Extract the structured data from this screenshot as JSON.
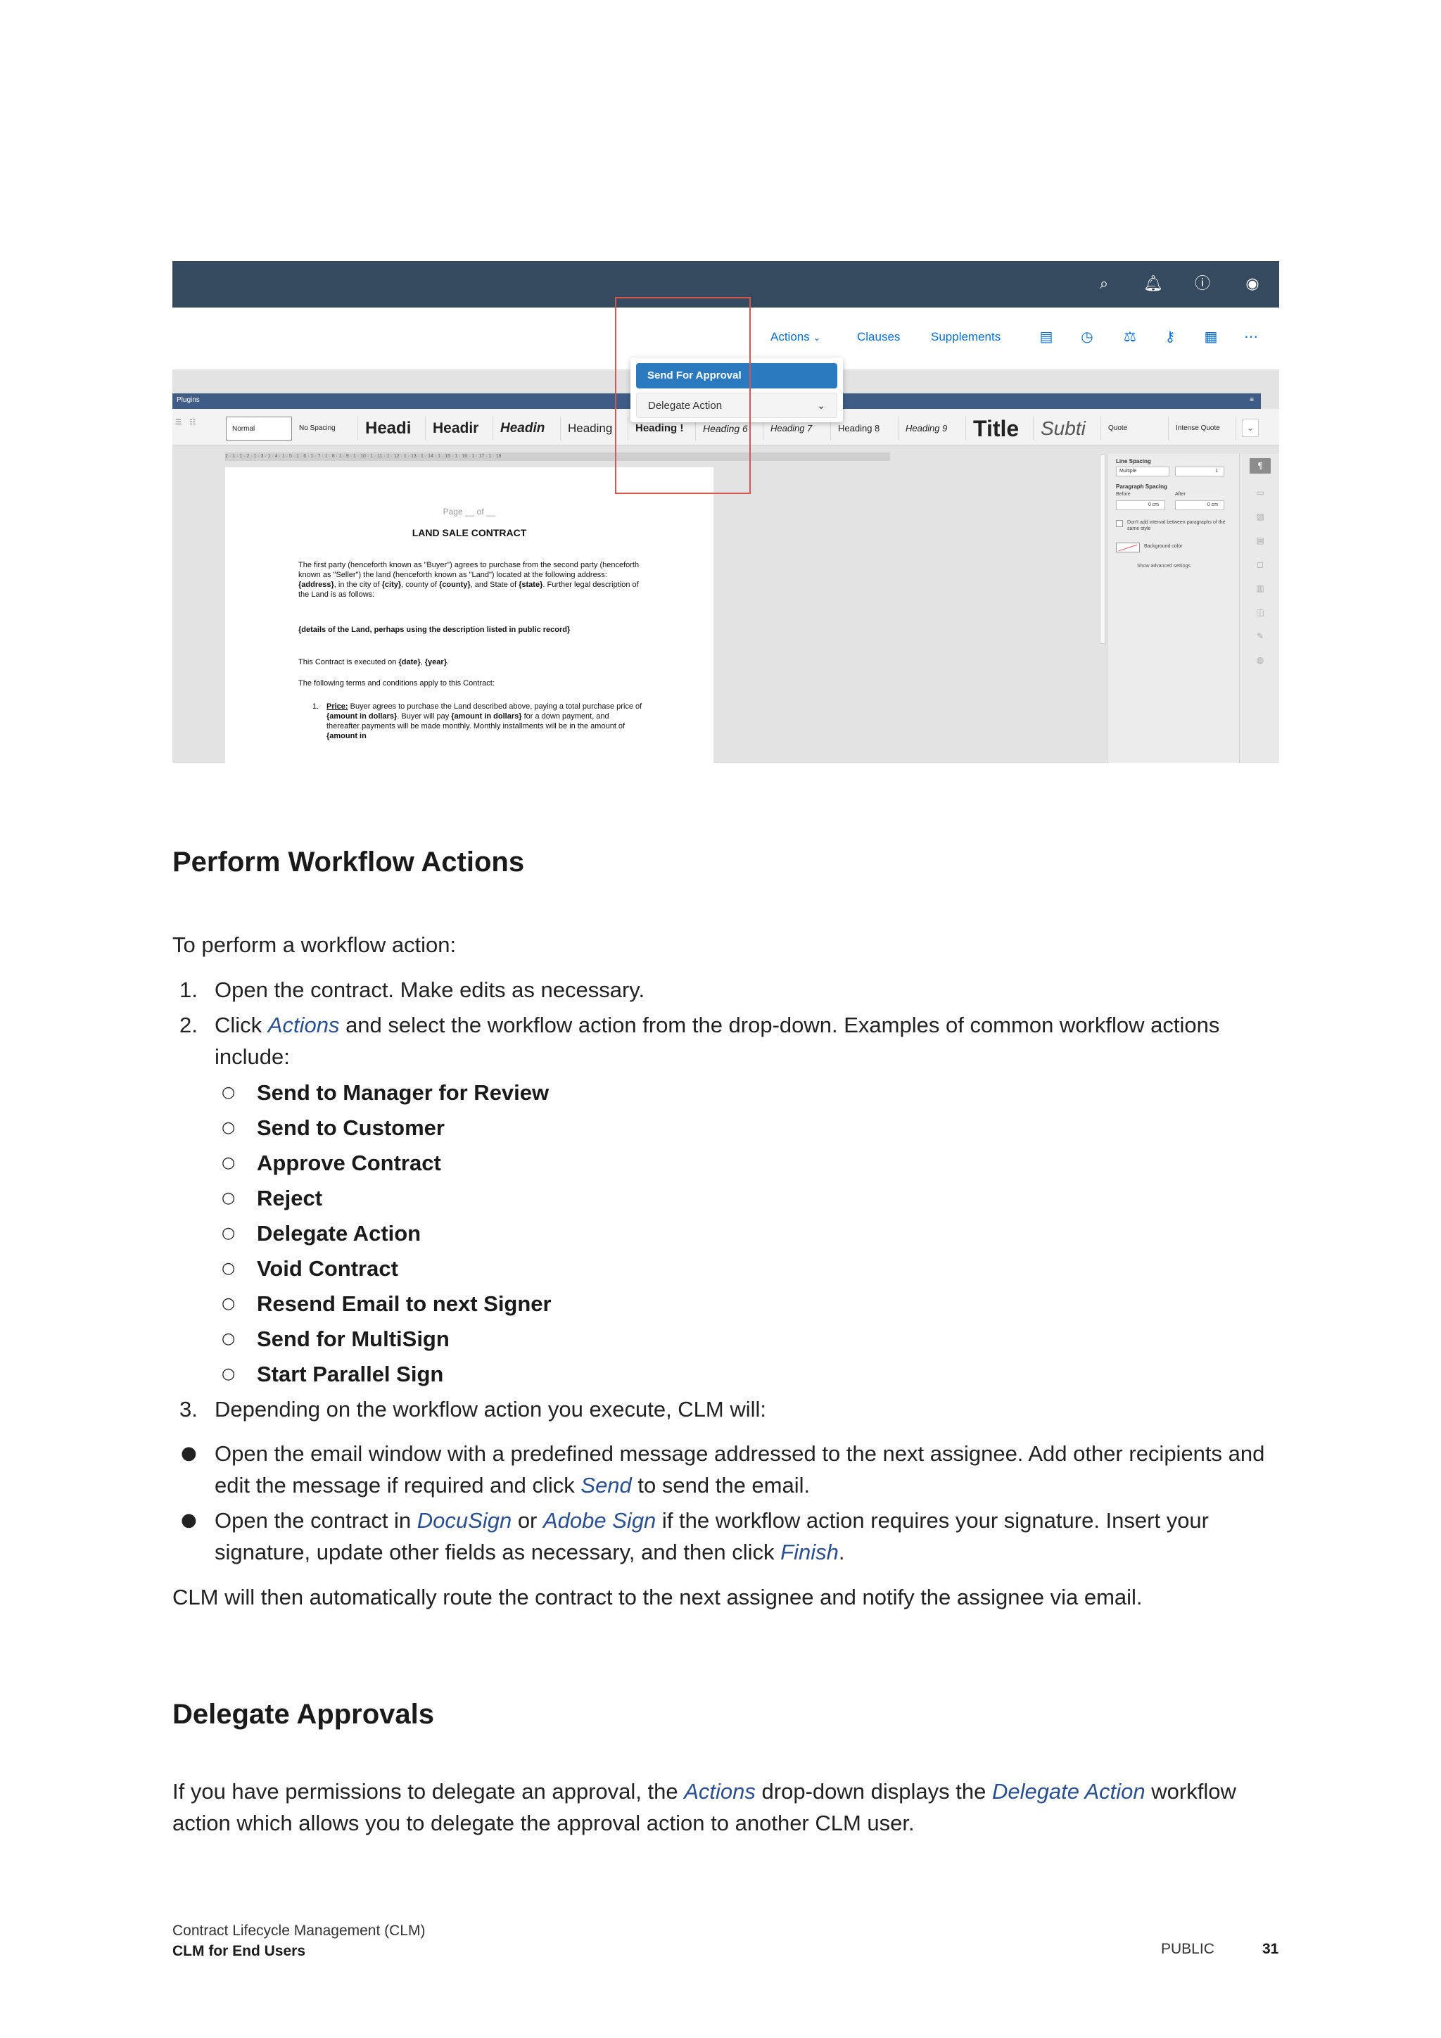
{
  "screenshot": {
    "toolbar": {
      "actions_label": "Actions",
      "clauses_label": "Clauses",
      "supplements_label": "Supplements"
    },
    "dropdown": {
      "items": [
        "Send For Approval",
        "Delegate Action"
      ]
    },
    "editor": {
      "plugins_label": "Plugins",
      "styles": [
        "Normal",
        "No Spacing",
        "Headi",
        "Headir",
        "Headin",
        "Heading",
        "Heading !",
        "Heading 6",
        "Heading 7",
        "Heading 8",
        "Heading 9",
        "Title",
        "Subti",
        "Quote",
        "Intense Quote"
      ],
      "ruler_text": "2 · 1 · 1 · 2 · 1 · 3 · 1 · 4 · 1 · 5 · 1 · 6 · 1 · 7 · 1 · 8 · 1 · 9 · 1 · 10 · 1 · 11 · 1 · 12 · 1 · 13 · 1 · 14 · 1 · 15 · 1 · 16 · 1 · 17 · 1 · 18",
      "page_number": "Page __ of __",
      "doc_title": "LAND SALE CONTRACT",
      "para1_a": "The first party (henceforth known as \"Buyer\") agrees to purchase from the second party (henceforth known as \"Seller\") the land (henceforth known as \"Land\") located at the following address: ",
      "para1_address": "{address}",
      "para1_b": ", in the city of ",
      "para1_city": "{city}",
      "para1_c": ", county of ",
      "para1_county": "{county}",
      "para1_d": ", and State of ",
      "para1_state": "{state}",
      "para1_e": ". Further legal description of the Land is as follows:",
      "para2": "{details of the Land, perhaps using the description listed in public record}",
      "para3_a": "This Contract is executed on ",
      "para3_date": "{date}",
      "para3_b": ", ",
      "para3_year": "{year}",
      "para3_c": ".",
      "para4": "The following terms and conditions apply to this Contract:",
      "item1_num": "1.",
      "item1_label": "Price:",
      "item1_a": " Buyer agrees to purchase the Land described above, paying a total purchase price of ",
      "item1_amount": "{amount in dollars}",
      "item1_b": ". Buyer will pay ",
      "item1_amount2": "{amount in dollars}",
      "item1_c": " for a down payment, and thereafter payments will be made monthly. Monthly installments will be in the amount of ",
      "item1_amount3": "{amount in",
      "side": {
        "line_spacing": "Line Spacing",
        "line_spacing_value": "Multiple",
        "line_spacing_num": "1",
        "paragraph_spacing": "Paragraph Spacing",
        "before": "Before",
        "after": "After",
        "before_value": "0 cm",
        "after_value": "0 cm",
        "no_interval": "Don't add interval between paragraphs of the same style",
        "background_color": "Background color",
        "advanced": "Show advanced settings"
      }
    }
  },
  "section1": {
    "heading": "Perform Workflow Actions",
    "intro": "To perform a workflow action:",
    "steps": [
      {
        "num": "1.",
        "text": "Open the contract. Make edits as necessary."
      },
      {
        "num": "2.",
        "pre": "Click ",
        "em": "Actions",
        "post": " and select the workflow action from the drop-down. Examples of common workflow actions include:"
      },
      {
        "num": "3.",
        "text": "Depending on the workflow action you execute, CLM will:"
      }
    ],
    "examples": [
      "Send to Manager for Review",
      "Send to Customer",
      "Approve Contract",
      "Reject",
      "Delegate Action",
      "Void Contract",
      "Resend Email to next Signer",
      "Send for MultiSign",
      "Start Parallel Sign"
    ],
    "bullet1": {
      "pre": "Open the email window with a predefined message addressed to the next assignee. Add other recipients and edit the message if required and click ",
      "em": "Send",
      "post": " to send the email."
    },
    "bullet2": {
      "pre": "Open the contract in ",
      "em1": "DocuSign",
      "mid": " or ",
      "em2": "Adobe Sign",
      "mid2": " if the workflow action requires your signature. Insert your signature, update other fields as necessary, and then click ",
      "em3": "Finish",
      "post": "."
    },
    "closing": "CLM will then automatically route the contract to the next assignee and notify the assignee via email."
  },
  "section2": {
    "heading": "Delegate Approvals",
    "pre": "If you have permissions to delegate an approval, the ",
    "em1": "Actions",
    "mid": " drop-down displays the ",
    "em2": "Delegate Action",
    "post": " workflow action which allows you to delegate the approval action to another CLM user."
  },
  "footer": {
    "line1": "Contract Lifecycle Management (CLM)",
    "line2": "CLM for End Users",
    "classification": "PUBLIC",
    "page": "31"
  },
  "colors": {
    "topbar": "#354a5f",
    "link": "#0a6ed1",
    "dropdown_selected": "#2b7abf",
    "highlight_border": "#d9534f",
    "emphasis": "#2a4f8f"
  }
}
